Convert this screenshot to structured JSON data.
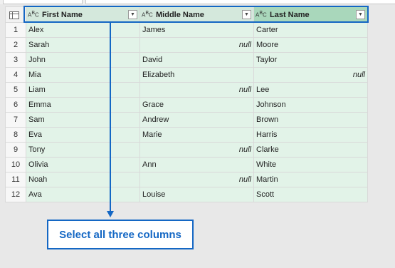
{
  "columns": [
    {
      "type_icon": "ABC",
      "label": "First Name"
    },
    {
      "type_icon": "ABC",
      "label": "Middle Name"
    },
    {
      "type_icon": "ABC",
      "label": "Last Name"
    }
  ],
  "rows": [
    {
      "index": "1",
      "first": "Alex",
      "middle": "James",
      "last": "Carter"
    },
    {
      "index": "2",
      "first": "Sarah",
      "middle": "null",
      "last": "Moore"
    },
    {
      "index": "3",
      "first": "John",
      "middle": "David",
      "last": "Taylor"
    },
    {
      "index": "4",
      "first": "Mia",
      "middle": "Elizabeth",
      "last": "null"
    },
    {
      "index": "5",
      "first": "Liam",
      "middle": "null",
      "last": "Lee"
    },
    {
      "index": "6",
      "first": "Emma",
      "middle": "Grace",
      "last": "Johnson"
    },
    {
      "index": "7",
      "first": "Sam",
      "middle": "Andrew",
      "last": "Brown"
    },
    {
      "index": "8",
      "first": "Eva",
      "middle": "Marie",
      "last": "Harris"
    },
    {
      "index": "9",
      "first": "Tony",
      "middle": "null",
      "last": "Clarke"
    },
    {
      "index": "10",
      "first": "Olivia",
      "middle": "Ann",
      "last": "White"
    },
    {
      "index": "11",
      "first": "Noah",
      "middle": "null",
      "last": "Martin"
    },
    {
      "index": "12",
      "first": "Ava",
      "middle": "Louise",
      "last": "Scott"
    }
  ],
  "callout": {
    "text": "Select all three columns"
  },
  "colors": {
    "accent": "#1467c4",
    "cell_bg": "#e2f3e8",
    "header_bg": "#d4e8dc",
    "selected_header_bg": "#a9d7bb"
  },
  "icons": {
    "corner": "table-icon",
    "column_type": "text-type-icon",
    "filter": "dropdown-icon"
  }
}
